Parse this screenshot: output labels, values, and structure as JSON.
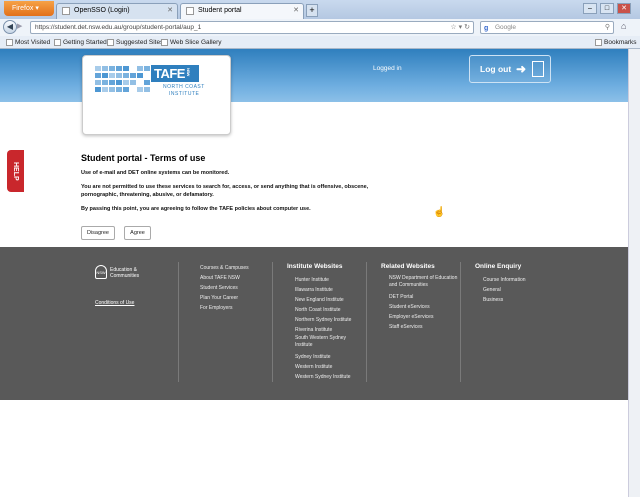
{
  "browser": {
    "menu_label": "Firefox",
    "tabs": [
      {
        "title": "OpenSSO (Login)"
      },
      {
        "title": "Student portal"
      }
    ],
    "new_tab": "+",
    "url": "https://student.det.nsw.edu.au/group/student-portal/aup_1",
    "search_engine": "Google",
    "bookmarks": [
      "Most Visited",
      "Getting Started",
      "Suggested Sites",
      "Web Slice Gallery"
    ],
    "bookmarks_menu": "Bookmarks"
  },
  "header": {
    "logo_text": "TAFE",
    "logo_sub1": "NORTH COAST",
    "logo_sub2": "INSTITUTE",
    "logged_in": "Logged in",
    "logout": "Log out"
  },
  "help_tab": "HELP",
  "content": {
    "title": "Student portal - Terms of use",
    "p1": "Use of e-mail and DET online systems can be monitored.",
    "p2": "You are not permitted to use these services to search for, access, or send anything that is offensive, obscene, pornographic, threatening, abusive, or defamatory.",
    "p3": "By passing this point, you are agreeing to follow the TAFE policies about computer use.",
    "disagree": "Disagree",
    "agree": "Agree"
  },
  "footer": {
    "nsw_logo": "NSW",
    "nsw_text1": "Education &",
    "nsw_text2": "Communities",
    "conditions": "Conditions of Use",
    "col1": [
      "Courses & Campuses",
      "About TAFE NSW",
      "Student Services",
      "Plan Your Career",
      "For Employers"
    ],
    "col2_title": "Institute Websites",
    "col2": [
      "Hunter Institute",
      "Illawarra Institute",
      "New England Institute",
      "North Coast Institute",
      "Northern Sydney Institute",
      "Riverina Institute",
      "South Western Sydney Institute",
      "Sydney Institute",
      "Western Institute",
      "Western Sydney Institute"
    ],
    "col3_title": "Related Websites",
    "col3": [
      "NSW Department of Education and Communities",
      "DET Portal",
      "Student eServices",
      "Employer eServices",
      "Staff eServices"
    ],
    "col4_title": "Online Enquiry",
    "col4": [
      "Course Information",
      "General",
      "Business"
    ]
  },
  "colors": {
    "header_blue": "#2f7fbe",
    "help_red": "#c9272c",
    "footer_grey": "#595959"
  }
}
